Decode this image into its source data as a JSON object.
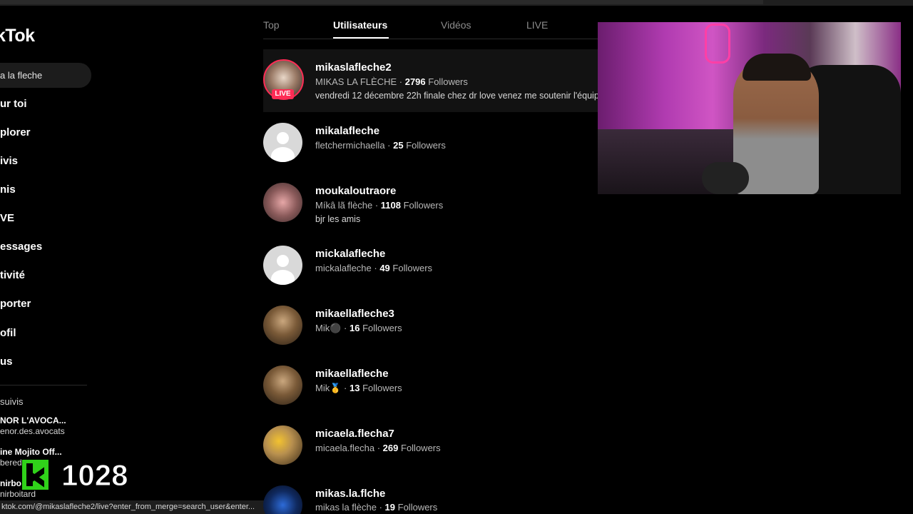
{
  "sidebar": {
    "logo": "kTok",
    "search_value": "a la fleche",
    "nav": [
      "ur toi",
      "plorer",
      "ivis",
      "nis",
      "VE",
      "essages",
      "tivité",
      "porter",
      "ofil",
      "us"
    ],
    "following_title": "suivis",
    "following": [
      {
        "name": "NOR L'AVOCA...",
        "handle": "enor.des.avocats"
      },
      {
        "name": "ine Mojito Off...",
        "handle": "bered"
      },
      {
        "name": "nirbo",
        "handle": "nirboitard"
      }
    ]
  },
  "overlay": {
    "counter": "1028",
    "status_url": "ktok.com/@mikaslafleche2/live?enter_from_merge=search_user&enter..."
  },
  "tabs": [
    "Top",
    "Utilisateurs",
    "Vidéos",
    "LIVE"
  ],
  "active_tab": "Utilisateurs",
  "results": [
    {
      "username": "mikaslafleche2",
      "nickname": "MIKAS LA FLÈCHE",
      "followers": "2796",
      "followers_label": "Followers",
      "bio": "vendredi 12 décembre 22h finale chez dr love venez me soutenir l'équipe",
      "live": true,
      "live_label": "LIVE"
    },
    {
      "username": "mikalafleche",
      "nickname": "fletchermichaella",
      "followers": "25",
      "followers_label": "Followers",
      "bio": ""
    },
    {
      "username": "moukaloutraore",
      "nickname": "Míkâ lã flèche",
      "followers": "1108",
      "followers_label": "Followers",
      "bio": "bjr les amis"
    },
    {
      "username": "mickalafleche",
      "nickname": "mickalafleche",
      "followers": "49",
      "followers_label": "Followers",
      "bio": ""
    },
    {
      "username": "mikaellafleche3",
      "nickname": "Mik⚫",
      "followers": "16",
      "followers_label": "Followers",
      "bio": ""
    },
    {
      "username": "mikaellafleche",
      "nickname": "Mik🥇",
      "followers": "13",
      "followers_label": "Followers",
      "bio": ""
    },
    {
      "username": "micaela.flecha7",
      "nickname": "micaela.flecha",
      "followers": "269",
      "followers_label": "Followers",
      "bio": ""
    },
    {
      "username": "mikas.la.flche",
      "nickname": "mikas la flèche",
      "followers": "19",
      "followers_label": "Followers",
      "bio": ""
    }
  ],
  "colors": {
    "background": "#000000",
    "live": "#fe2c55",
    "counter_green": "#30d21a"
  }
}
